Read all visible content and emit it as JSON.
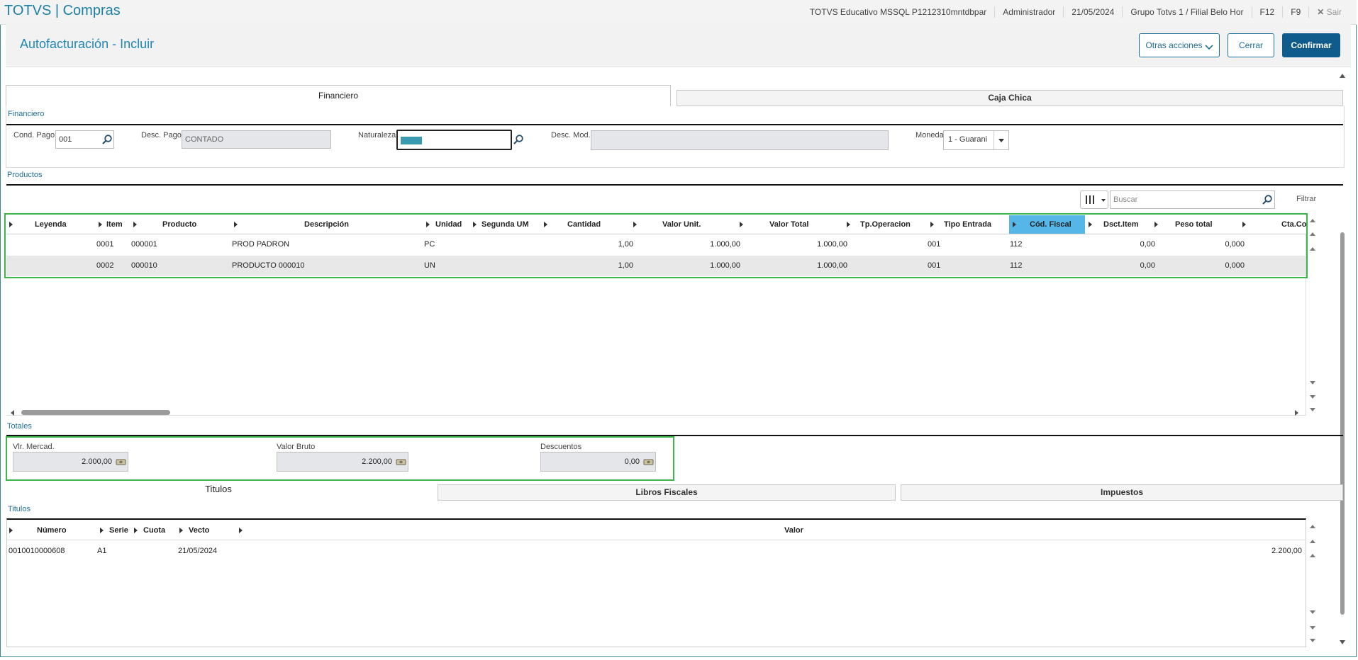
{
  "topbar": {
    "app_title": "TOTVS | Compras",
    "environment": "TOTVS Educativo MSSQL P1212310mntdbpar",
    "user": "Administrador",
    "date": "21/05/2024",
    "branch": "Grupo Totvs 1 / Filial Belo Hor",
    "f12": "F12",
    "f9": "F9",
    "exit": "Sair"
  },
  "header": {
    "title": "Autofacturación - Incluir",
    "other_actions": "Otras acciones",
    "close": "Cerrar",
    "confirm": "Confirmar"
  },
  "tabs_top": {
    "active": "Financiero",
    "inactive": "Caja Chica"
  },
  "financiero": {
    "section": "Financiero",
    "cond_pago_label": "Cond. Pago",
    "cond_pago_value": "001",
    "desc_pago_label": "Desc. Pago",
    "desc_pago_value": "CONTADO",
    "naturaleza_label": "Naturaleza",
    "naturaleza_value": "",
    "desc_mod_label": "Desc. Mod.",
    "desc_mod_value": "",
    "moneda_label": "Moneda",
    "moneda_value": "1 - Guarani"
  },
  "productos": {
    "section": "Productos",
    "search_placeholder": "Buscar",
    "filter": "Filtrar",
    "columns": [
      "Leyenda",
      "Item",
      "Producto",
      "Descripción",
      "Unidad",
      "Segunda UM",
      "Cantidad",
      "Valor Unit.",
      "Valor Total",
      "Tp.Operacion",
      "Tipo Entrada",
      "Cód. Fiscal",
      "Dsct.Item",
      "Peso total",
      "Cta.Co"
    ],
    "rows": [
      {
        "item": "0001",
        "producto": "000001",
        "descripcion": "PROD PADRON",
        "unidad": "PC",
        "cantidad": "1,00",
        "valor_unit": "1.000,00",
        "valor_total": "1.000,00",
        "tipo_entrada": "001",
        "cod_fiscal": "112",
        "dsct_item": "0,00",
        "peso_total": "0,000"
      },
      {
        "item": "0002",
        "producto": "000010",
        "descripcion": "PRODUCTO 000010",
        "unidad": "UN",
        "cantidad": "1,00",
        "valor_unit": "1.000,00",
        "valor_total": "1.000,00",
        "tipo_entrada": "001",
        "cod_fiscal": "112",
        "dsct_item": "0,00",
        "peso_total": "0,000"
      }
    ]
  },
  "totales": {
    "section": "Totales",
    "vlr_mercad_label": "Vlr. Mercad.",
    "vlr_mercad_value": "2.000,00",
    "valor_bruto_label": "Valor Bruto",
    "valor_bruto_value": "2.200,00",
    "descuentos_label": "Descuentos",
    "descuentos_value": "0,00"
  },
  "tabs_bottom": {
    "active": "Titulos",
    "libros": "Libros Fiscales",
    "impuestos": "Impuestos"
  },
  "titulos": {
    "section": "Titulos",
    "columns": [
      "Número",
      "Serie",
      "Cuota",
      "Vecto",
      "Valor"
    ],
    "rows": [
      {
        "numero": "0010010000608",
        "serie": "A1",
        "cuota": "",
        "vecto": "21/05/2024",
        "valor": "2.200,00"
      }
    ]
  },
  "colors": {
    "accent": "#1f86b5",
    "primary_button": "#0f5c8c",
    "highlight_column": "#56b6e8",
    "annotation_green": "#3cb54a"
  }
}
